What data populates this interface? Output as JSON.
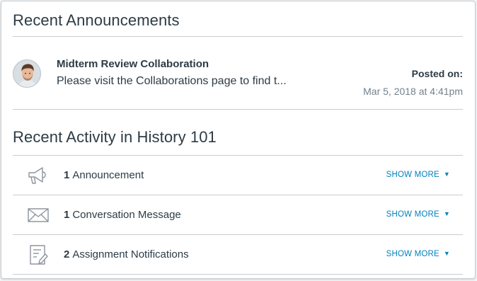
{
  "announcements": {
    "heading": "Recent Announcements",
    "item": {
      "title": "Midterm Review Collaboration",
      "preview": "Please visit the Collaborations page to find t...",
      "posted_label": "Posted on:",
      "posted_date": "Mar 5, 2018 at 4:41pm"
    }
  },
  "activity": {
    "heading": "Recent Activity in History 101",
    "rows": [
      {
        "count": "1",
        "label": "Announcement",
        "icon": "megaphone-icon",
        "action": "SHOW MORE",
        "caret": "▼"
      },
      {
        "count": "1",
        "label": "Conversation Message",
        "icon": "envelope-icon",
        "action": "SHOW MORE",
        "caret": "▼"
      },
      {
        "count": "2",
        "label": "Assignment Notifications",
        "icon": "assignment-icon",
        "action": "SHOW MORE",
        "caret": "▼"
      }
    ]
  },
  "colors": {
    "link": "#0081bd",
    "text": "#2d3b45",
    "muted": "#73818c",
    "border": "#c7cdd1"
  }
}
